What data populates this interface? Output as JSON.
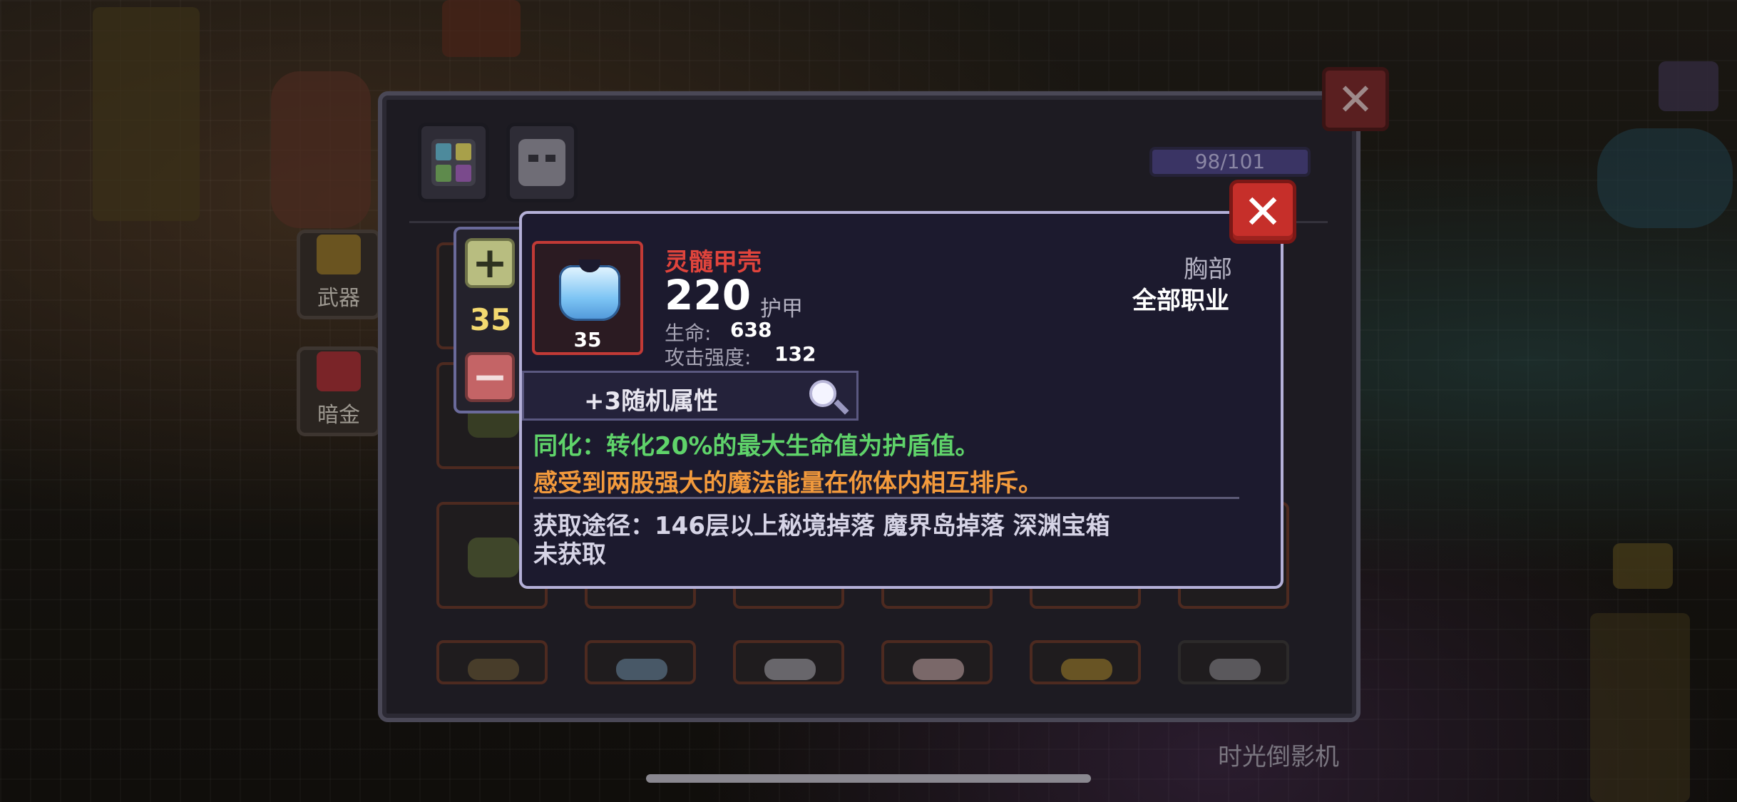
{
  "inventory": {
    "capacity": "98/101",
    "side_buttons": [
      "武器",
      "暗金"
    ]
  },
  "stepper": {
    "plus": "+",
    "minus": "−",
    "count": "35"
  },
  "item": {
    "name": "灵髓甲壳",
    "level": "35",
    "armor_value": "220",
    "armor_label": "护甲",
    "stats": [
      {
        "label": "生命:",
        "value": "638"
      },
      {
        "label": "攻击强度:",
        "value": "132"
      }
    ],
    "slot_type": "胸部",
    "class": "全部职业",
    "random_attrs": "+3随机属性",
    "effect": "同化：转化20%的最大生命值为护盾值。",
    "flavor": "感受到两股强大的魔法能量在你体内相互排斥。",
    "source": "获取途径：146层以上秘境掉落 魔界岛掉落 深渊宝箱",
    "status": "未获取"
  },
  "close_glyph": "✕",
  "scene": {
    "machine_label": "时光倒影机"
  },
  "colors": {
    "item_name": "#e0443c",
    "effect": "#5fd36a",
    "flavor": "#f39a3c",
    "count": "#f3d970",
    "close_button": "#c62f2a"
  }
}
